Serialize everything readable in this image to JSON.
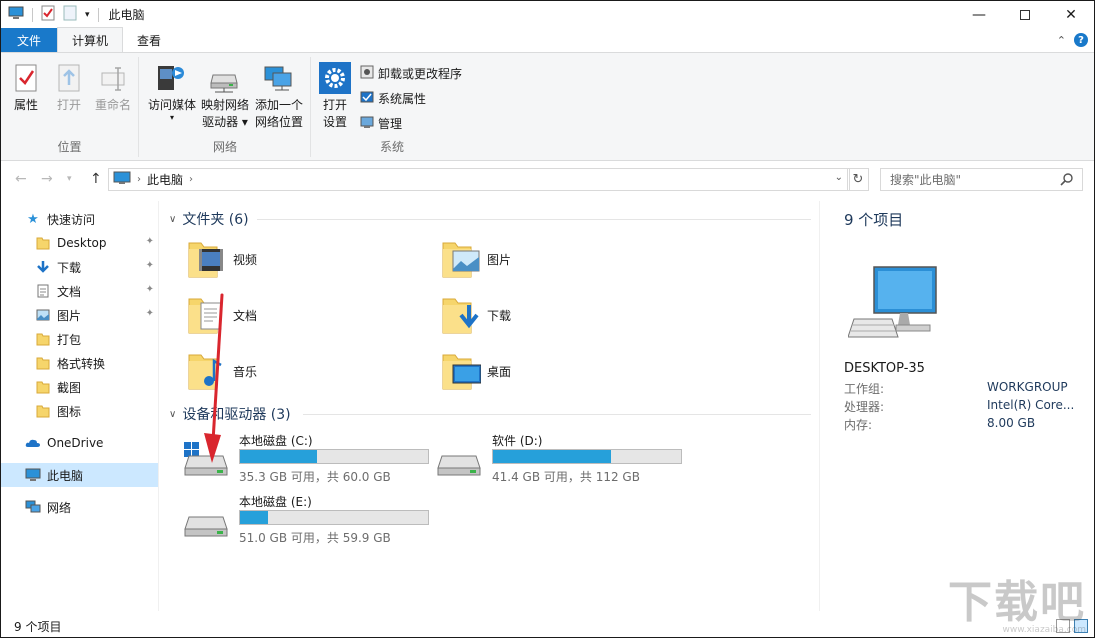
{
  "window": {
    "title": "此电脑"
  },
  "tabs": [
    {
      "label": "文件"
    },
    {
      "label": "计算机"
    },
    {
      "label": "查看"
    }
  ],
  "ribbon": {
    "groups": [
      {
        "label": "位置"
      },
      {
        "label": "网络"
      },
      {
        "label": "系统"
      }
    ],
    "location": {
      "properties": "属性",
      "open": "打开",
      "rename": "重命名"
    },
    "network": {
      "media_1": "访问媒体",
      "map_1": "映射网络",
      "map_2": "驱动器",
      "add_1": "添加一个",
      "add_2": "网络位置"
    },
    "system": {
      "open_settings_1": "打开",
      "open_settings_2": "设置",
      "uninstall": "卸载或更改程序",
      "sys_props": "系统属性",
      "manage": "管理"
    }
  },
  "address": {
    "path": "此电脑",
    "search_placeholder": "搜索\"此电脑\""
  },
  "nav": {
    "quick_access": "快速访问",
    "items": [
      {
        "label": "Desktop",
        "icon": "folder-icon",
        "pinned": true
      },
      {
        "label": "下载",
        "icon": "download-icon",
        "pinned": true
      },
      {
        "label": "文档",
        "icon": "document-icon",
        "pinned": true
      },
      {
        "label": "图片",
        "icon": "picture-icon",
        "pinned": true
      },
      {
        "label": "打包",
        "icon": "folder-icon",
        "pinned": false
      },
      {
        "label": "格式转换",
        "icon": "folder-icon",
        "pinned": false
      },
      {
        "label": "截图",
        "icon": "folder-icon",
        "pinned": false
      },
      {
        "label": "图标",
        "icon": "folder-icon",
        "pinned": false
      }
    ],
    "onedrive": "OneDrive",
    "this_pc": "此电脑",
    "network": "网络"
  },
  "content": {
    "folders_header": "文件夹 (6)",
    "folders": [
      "视频",
      "图片",
      "文档",
      "下载",
      "音乐",
      "桌面"
    ],
    "devices_header": "设备和驱动器 (3)",
    "drives": [
      {
        "name": "本地磁盘 (C:)",
        "free_text": "35.3 GB 可用，共 60.0 GB",
        "used_fraction": 0.41
      },
      {
        "name": "软件 (D:)",
        "free_text": "41.4 GB 可用，共 112 GB",
        "used_fraction": 0.63
      },
      {
        "name": "本地磁盘 (E:)",
        "free_text": "51.0 GB 可用，共 59.9 GB",
        "used_fraction": 0.15
      }
    ]
  },
  "details": {
    "count": "9 个项目",
    "computer_name": "DESKTOP-35",
    "props": [
      {
        "label": "工作组:",
        "value": "WORKGROUP"
      },
      {
        "label": "处理器:",
        "value": "Intel(R) Core..."
      },
      {
        "label": "内存:",
        "value": "8.00 GB"
      }
    ]
  },
  "status": {
    "count": "9 个项目"
  },
  "watermark": {
    "text": "下载吧",
    "sub": "www.xiazaiba.com"
  },
  "colors": {
    "accent": "#1979ca",
    "drive_fill": "#26a0da",
    "folder": "#f6d56b",
    "selection": "#cce8ff",
    "annotation_arrow": "#d9262e"
  }
}
